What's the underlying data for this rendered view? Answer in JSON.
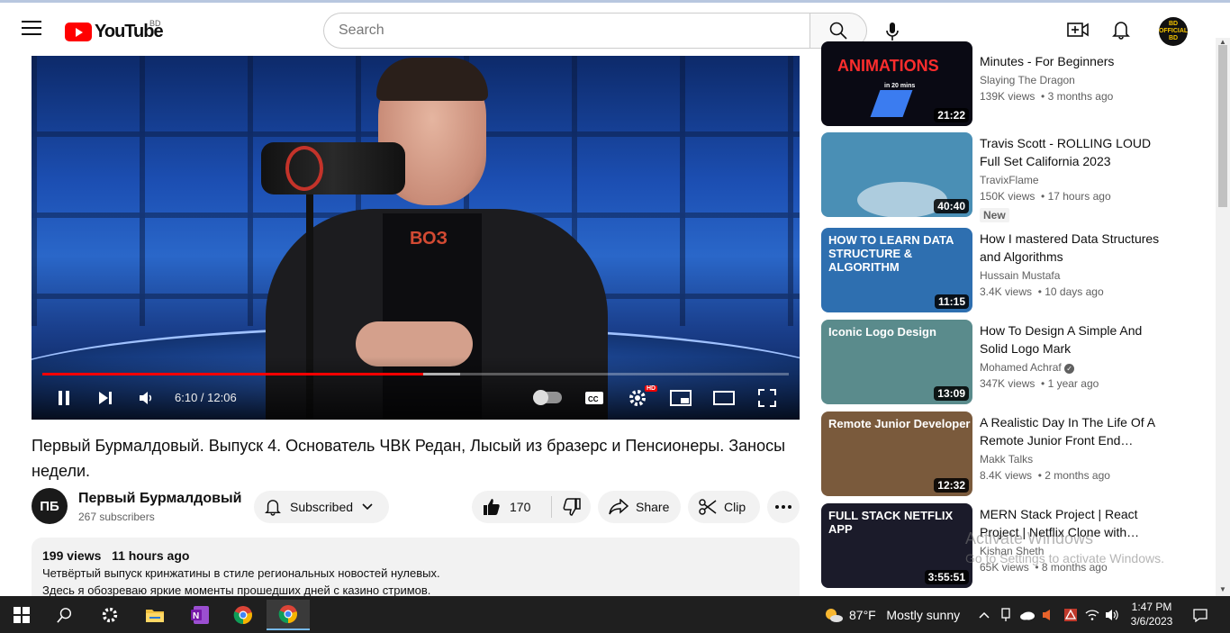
{
  "header": {
    "logo_text": "YouTube",
    "logo_region": "BD",
    "search_placeholder": "Search",
    "avatar_text": "BD OFFICIAL BD"
  },
  "player": {
    "time": "6:10 / 12:06",
    "progress_played": 0.51,
    "progress_buffered": 0.56,
    "shirt_text": "ВОЗ",
    "hd_badge": "HD"
  },
  "video": {
    "title": "Первый Бурмалдовый. Выпуск 4. Основатель ЧВК Редан, Лысый из бразерс и Пенсионеры. Заносы недели.",
    "channel_avatar": "ПБ",
    "channel_name": "Первый Бурмалдовый",
    "subscribers": "267 subscribers",
    "subscribed_label": "Subscribed",
    "likes": "170",
    "share_label": "Share",
    "clip_label": "Clip"
  },
  "description": {
    "views": "199 views",
    "age": "11 hours ago",
    "line1": "Четвёртый выпуск кринжатины в стиле региональных новостей нулевых.",
    "line2": "Здесь я обозреваю яркие моменты прошедших дней с казино стримов."
  },
  "recommendations": [
    {
      "title": "Minutes - For Beginners",
      "channel": "Slaying The Dragon",
      "views": "139K views",
      "age": "3 months ago",
      "duration": "21:22",
      "thumb_text": "ANIMATIONS",
      "thumb_sub": "in 20 mins",
      "thumb_color": "#0a0a14"
    },
    {
      "title": "Travis Scott - ROLLING LOUD Full Set California 2023",
      "channel": "TravixFlame",
      "views": "150K views",
      "age": "17 hours ago",
      "duration": "40:40",
      "badge": "New",
      "thumb_text": "",
      "thumb_color": "#4a8fb5"
    },
    {
      "title": "How I mastered Data Structures and Algorithms",
      "channel": "Hussain Mustafa",
      "views": "3.4K views",
      "age": "10 days ago",
      "duration": "11:15",
      "thumb_text": "HOW TO LEARN DATA STRUCTURE & ALGORITHM",
      "thumb_color": "#2e6fb0"
    },
    {
      "title": "How To Design A Simple And Solid Logo Mark",
      "channel": "Mohamed Achraf",
      "views": "347K views",
      "age": "1 year ago",
      "duration": "13:09",
      "thumb_text": "Iconic Logo Design",
      "thumb_color": "#5a8b8c",
      "verified": true
    },
    {
      "title": "A Realistic Day In The Life Of A Remote Junior Front End…",
      "channel": "Makk Talks",
      "views": "8.4K views",
      "age": "2 months ago",
      "duration": "12:32",
      "thumb_text": "Remote Junior Developer",
      "thumb_color": "#7a5a3c"
    },
    {
      "title": "MERN Stack Project | React Project | Netflix Clone with…",
      "channel": "Kishan Sheth",
      "views": "65K views",
      "age": "8 months ago",
      "duration": "3:55:51",
      "thumb_text": "FULL STACK NETFLIX APP",
      "thumb_color": "#1b1b2a"
    }
  ],
  "watermark": {
    "line1": "Activate Windows",
    "line2": "Go to Settings to activate Windows."
  },
  "taskbar": {
    "temperature": "87°F",
    "weather": "Mostly sunny",
    "time": "1:47 PM",
    "date": "3/6/2023"
  },
  "colors": {
    "accent_red": "#ff0000",
    "taskbar": "#1f1f1f"
  }
}
